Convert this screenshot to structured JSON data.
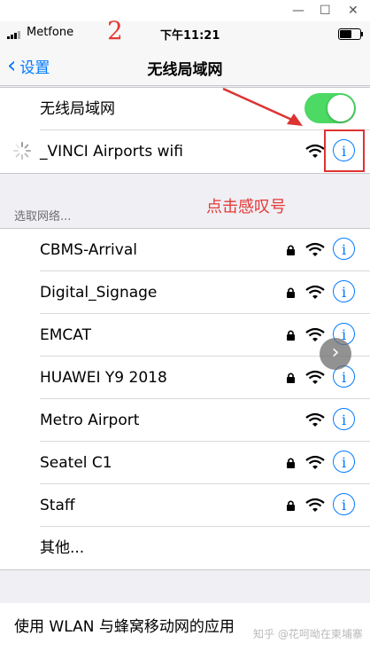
{
  "window_controls": {
    "minimize": "—",
    "maximize": "☐",
    "close": "✕"
  },
  "status_bar": {
    "carrier": "Metfone",
    "time": "下午11:21",
    "annotation_number": "2"
  },
  "nav": {
    "back_label": "设置",
    "title": "无线局域网"
  },
  "wifi_toggle": {
    "label": "无线局域网",
    "on": true
  },
  "connected_network": {
    "name": "_VINCI Airports wifi"
  },
  "section_header": "选取网络...",
  "annotation_text": "点击感叹号",
  "networks": [
    {
      "name": "CBMS-Arrival",
      "locked": true
    },
    {
      "name": "Digital_Signage",
      "locked": true
    },
    {
      "name": "EMCAT",
      "locked": true
    },
    {
      "name": "HUAWEI Y9 2018",
      "locked": true
    },
    {
      "name": "Metro Airport",
      "locked": false
    },
    {
      "name": "Seatel C1",
      "locked": true
    },
    {
      "name": "Staff",
      "locked": true
    }
  ],
  "other_label": "其他...",
  "bottom_row_label": "使用 WLAN 与蜂窝移动网的应用",
  "watermark": "知乎 @花呵呦在柬埔寨",
  "info_glyph": "i",
  "colors": {
    "accent": "#007aff",
    "toggle_on": "#4cd964",
    "annotation": "#e53935"
  }
}
